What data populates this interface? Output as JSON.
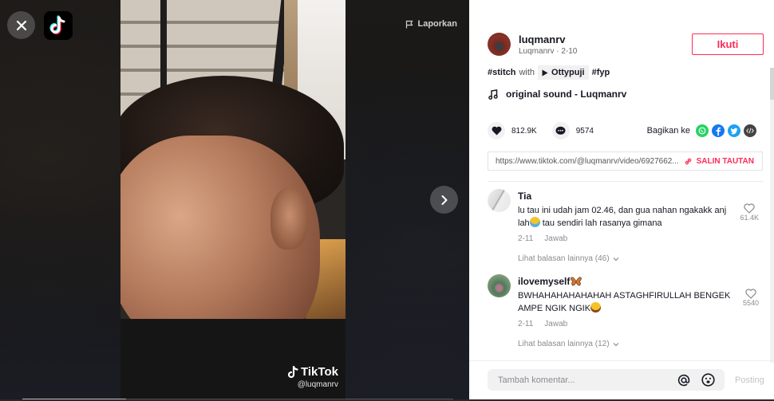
{
  "video": {
    "close_icon": "close-icon",
    "logo_icon": "tiktok-logo-icon",
    "report_label": "Laporkan",
    "watermark_brand": "TikTok",
    "watermark_user": "@luqmanrv",
    "next_icon": "chevron-right-icon",
    "progress_fraction": 0.24
  },
  "author": {
    "username": "luqmanrv",
    "display_name": "Luqmanrv",
    "date": "2-10",
    "subline": "Luqmanrv · 2-10",
    "follow_label": "Ikuti"
  },
  "caption": {
    "hashtag1": "#stitch",
    "with_text": "with",
    "stitch_user": "Ottypuji",
    "hashtag2": "#fyp"
  },
  "sound": {
    "title": "original sound - Luqmanrv"
  },
  "stats": {
    "likes": "812.9K",
    "comments": "9574"
  },
  "share": {
    "label": "Bagikan ke",
    "targets": [
      "whatsapp",
      "facebook",
      "twitter",
      "embed"
    ]
  },
  "link": {
    "url": "https://www.tiktok.com/@luqmanrv/video/6927662...",
    "copy_label": "SALIN TAUTAN"
  },
  "comments": [
    {
      "username": "Tia",
      "text": "lu tau ini udah jam 02.46, dan gua nahan ngakakk anj lah",
      "text_after_emoji": " tau sendiri lah rasanya gimana",
      "date": "2-11",
      "reply_label": "Jawab",
      "likes": "61.4K",
      "more_replies": "Lihat balasan lainnya (46)"
    },
    {
      "username": "ilovemyself",
      "text": "BWHAHAHAHAHAHAH ASTAGHFIRULLAH BENGEK AMPE NGIK NGIK",
      "date": "2-11",
      "reply_label": "Jawab",
      "likes": "5540",
      "more_replies": "Lihat balasan lainnya (12)"
    }
  ],
  "comment_box": {
    "placeholder": "Tambah komentar...",
    "post_label": "Posting"
  },
  "colors": {
    "accent": "#fe2c55",
    "whatsapp": "#25d366",
    "facebook": "#1877f2",
    "twitter": "#1da1f2",
    "embed": "#444444"
  }
}
